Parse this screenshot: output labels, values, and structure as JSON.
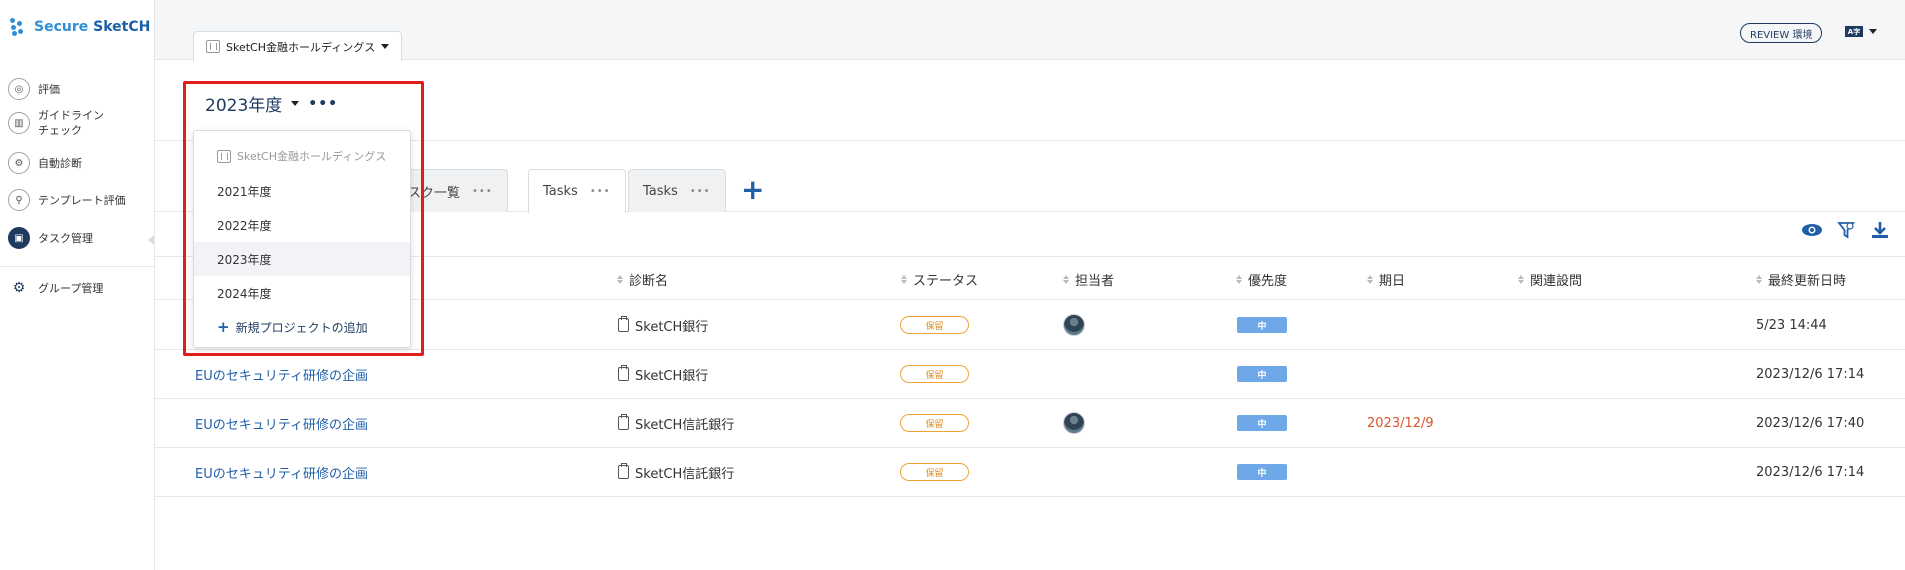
{
  "app": {
    "logo_text_a": "Secure ",
    "logo_text_b": "SketCH",
    "brand_color": "#2f8fd8"
  },
  "sidebar": {
    "items": [
      {
        "label": "評価",
        "icon": "globe-icon"
      },
      {
        "label": "ガイドライン\nチェック",
        "icon": "chart-icon"
      },
      {
        "label": "自動診断",
        "icon": "gear-shield-icon"
      },
      {
        "label": "テンプレート評価",
        "icon": "search-icon"
      },
      {
        "label": "タスク管理",
        "icon": "clipboard-icon"
      },
      {
        "label": "グループ管理",
        "icon": "gear-icon"
      }
    ]
  },
  "topbar": {
    "org_tab_label": "SketCH金融ホールディングス",
    "review_badge": "REVIEW 環境",
    "lang_label": "A字"
  },
  "year_header": {
    "title": "2023年度",
    "more": "•••"
  },
  "dropdown": {
    "header": "SketCH金融ホールディングス",
    "items": [
      "2021年度",
      "2022年度",
      "2023年度",
      "2024年度"
    ],
    "selected": "2023年度",
    "add_label": "新規プロジェクトの追加"
  },
  "tabs": {
    "items": [
      {
        "label": "タスク一覧",
        "more": "•••"
      },
      {
        "label": "Tasks",
        "more": "•••"
      },
      {
        "label": "Tasks",
        "more": "•••"
      }
    ],
    "add": "+"
  },
  "table": {
    "headers": {
      "diagnosis": "診断名",
      "status": "ステータス",
      "assignee": "担当者",
      "priority": "優先度",
      "due": "期日",
      "related": "関連設問",
      "updated": "最終更新日時"
    },
    "rows": [
      {
        "task": "",
        "diagnosis": "SketCH銀行",
        "status": "保留",
        "assignee": true,
        "priority": "中",
        "due": "",
        "updated": "5/23 14:44"
      },
      {
        "task": "EUのセキュリティ研修の企画",
        "diagnosis": "SketCH銀行",
        "status": "保留",
        "assignee": false,
        "priority": "中",
        "due": "",
        "updated": "2023/12/6 17:14"
      },
      {
        "task": "EUのセキュリティ研修の企画",
        "diagnosis": "SketCH信託銀行",
        "status": "保留",
        "assignee": true,
        "priority": "中",
        "due": "2023/12/9",
        "updated": "2023/12/6 17:40"
      },
      {
        "task": "EUのセキュリティ研修の企画",
        "diagnosis": "SketCH信託銀行",
        "status": "保留",
        "assignee": false,
        "priority": "中",
        "due": "",
        "updated": "2023/12/6 17:14"
      }
    ]
  },
  "colors": {
    "accent": "#1f5fa8",
    "navy": "#1f3a5f",
    "status_orange": "#f0a33a",
    "priority_blue": "#6fa8e8",
    "highlight_red": "#e31b1b",
    "due_red": "#d9552c"
  }
}
